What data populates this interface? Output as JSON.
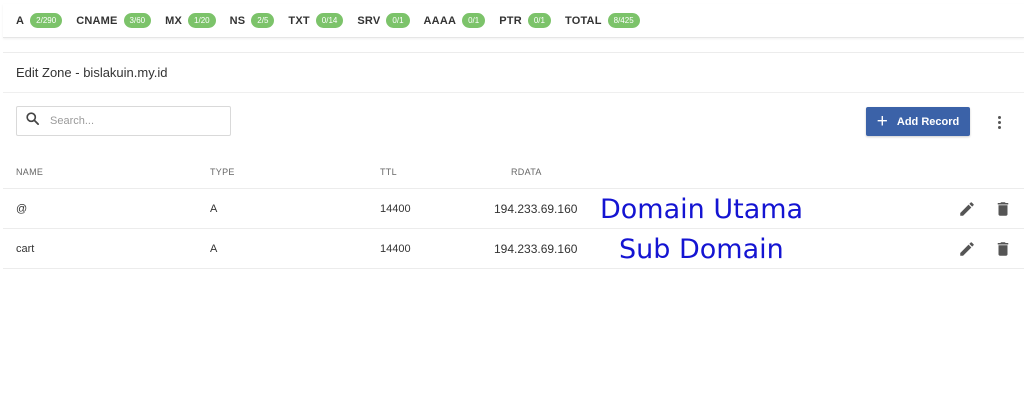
{
  "record_counts": [
    {
      "type": "A",
      "count": "2/290"
    },
    {
      "type": "CNAME",
      "count": "3/60"
    },
    {
      "type": "MX",
      "count": "1/20"
    },
    {
      "type": "NS",
      "count": "2/5"
    },
    {
      "type": "TXT",
      "count": "0/14"
    },
    {
      "type": "SRV",
      "count": "0/1"
    },
    {
      "type": "AAAA",
      "count": "0/1"
    },
    {
      "type": "PTR",
      "count": "0/1"
    },
    {
      "type": "TOTAL",
      "count": "8/425"
    }
  ],
  "zone": {
    "title": "Edit Zone - bislakuin.my.id"
  },
  "search": {
    "placeholder": "Search...",
    "value": ""
  },
  "toolbar": {
    "add_record_label": "Add Record",
    "plus_glyph": "+"
  },
  "table": {
    "columns": [
      "NAME",
      "TYPE",
      "TTL",
      "RDATA"
    ],
    "rows": [
      {
        "name": "@",
        "type": "A",
        "ttl": "14400",
        "rdata": "194.233.69.160",
        "note": "Domain Utama"
      },
      {
        "name": "cart",
        "type": "A",
        "ttl": "14400",
        "rdata": "194.233.69.160",
        "note": "Sub Domain"
      }
    ]
  },
  "colors": {
    "badge": "#7cc36a",
    "primary_button": "#3b62a8",
    "annotation": "#1414d2"
  }
}
